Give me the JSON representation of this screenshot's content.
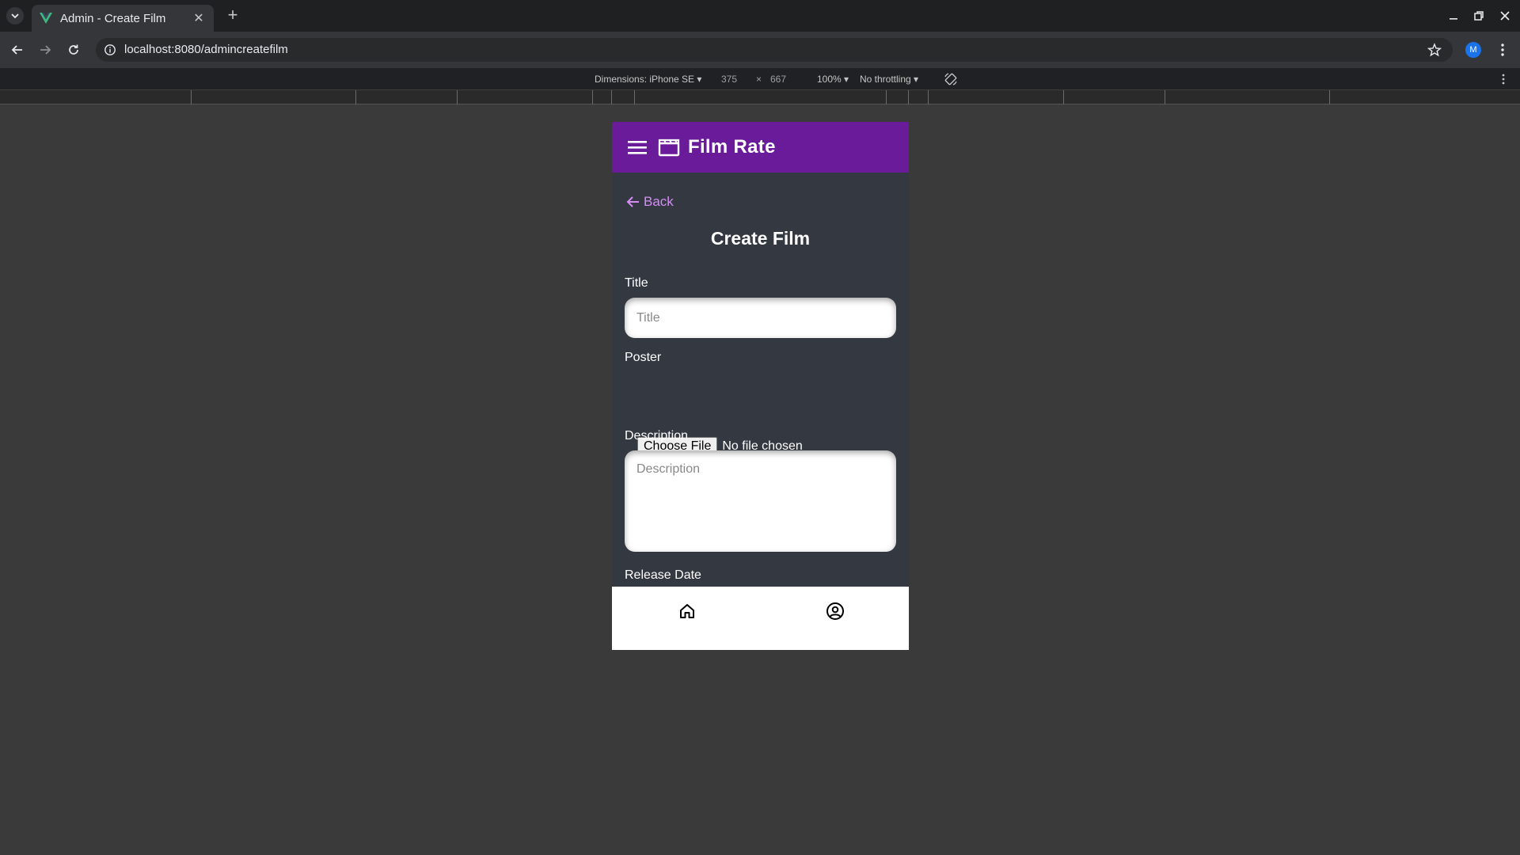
{
  "browser": {
    "tab_title": "Admin - Create Film",
    "url": "localhost:8080/admincreatefilm",
    "profile_initial": "M"
  },
  "devtools": {
    "dimensions_label": "Dimensions: iPhone SE",
    "width": "375",
    "times": "×",
    "height": "667",
    "zoom": "100%",
    "throttling": "No throttling"
  },
  "app": {
    "brand": "Film Rate",
    "accent_color": "#6a1b9a",
    "link_color": "#d58df5"
  },
  "page": {
    "back_label": "Back",
    "title": "Create Film",
    "fields": {
      "title_label": "Title",
      "title_placeholder": "Title",
      "poster_label": "Poster",
      "file_button": "Choose File",
      "file_status": "No file chosen",
      "description_label": "Description",
      "description_placeholder": "Description",
      "release_date_label": "Release Date"
    }
  },
  "bottom_nav": {
    "items": [
      "home-icon",
      "account-circle-icon"
    ]
  }
}
